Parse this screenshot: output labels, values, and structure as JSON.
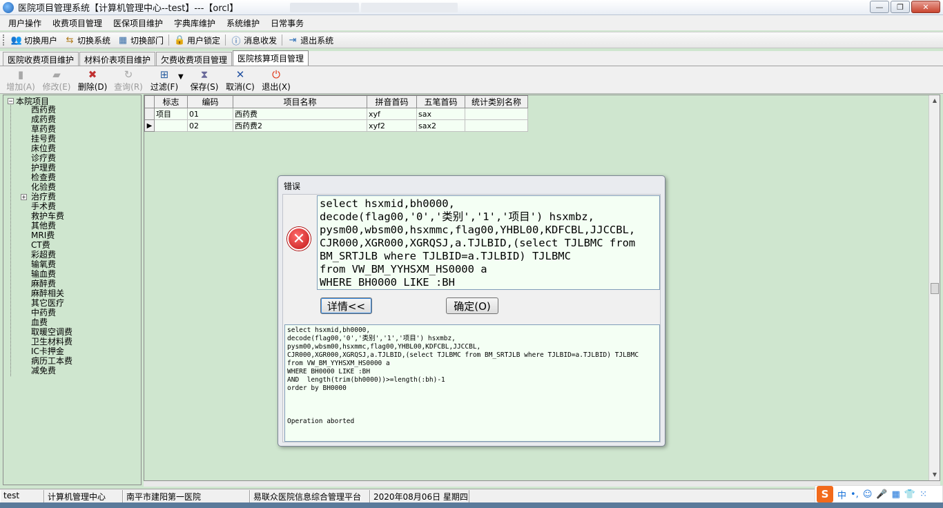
{
  "window": {
    "title": "医院项目管理系统【计算机管理中心--test】---【orcl】",
    "controls": [
      "—",
      "❐",
      "✕"
    ]
  },
  "menu": [
    "用户操作",
    "收费项目管理",
    "医保项目维护",
    "字典库维护",
    "系统维护",
    "日常事务"
  ],
  "toolbar": {
    "switch_user": "切换用户",
    "switch_system": "切换系统",
    "switch_dept": "切换部门",
    "lock_user": "用户锁定",
    "messages": "消息收发",
    "exit_system": "退出系统"
  },
  "tabs": [
    "医院收费项目维护",
    "材料价表项目维护",
    "欠费收费项目管理",
    "医院核算项目管理"
  ],
  "actions": {
    "add": "增加(A)",
    "edit": "修改(E)",
    "delete": "删除(D)",
    "query": "查询(R)",
    "filter": "过滤(F)",
    "save": "保存(S)",
    "cancel": "取消(C)",
    "exit": "退出(X)"
  },
  "tree": {
    "root": "本院项目",
    "root_expander": "−",
    "sub_expander": "+",
    "items": [
      "西药费",
      "成药费",
      "草药费",
      "挂号费",
      "床位费",
      "诊疗费",
      "护理费",
      "检查费",
      "化验费",
      "治疗费",
      "手术费",
      "救护车费",
      "其他费",
      "MRI费",
      "CT费",
      "彩超费",
      "输氧费",
      "输血费",
      "麻醉费",
      "麻醉相关",
      "其它医疗",
      "中药费",
      "血费",
      "取暖空调费",
      "卫生材料费",
      "IC卡押金",
      "病历工本费",
      "减免费"
    ]
  },
  "grid": {
    "columns": [
      "标志",
      "编码",
      "项目名称",
      "拼音首码",
      "五笔首码",
      "统计类别名称"
    ],
    "rows": [
      {
        "indicator": "",
        "flag": "项目",
        "code": "01",
        "name": "西药费",
        "pinyin": "xyf",
        "wubi": "sax",
        "category": ""
      },
      {
        "indicator": "▶",
        "flag": "",
        "code": "02",
        "name": "西药费2",
        "pinyin": "xyf2",
        "wubi": "sax2",
        "category": ""
      }
    ]
  },
  "dialog": {
    "title": "错误",
    "message": "select hsxmid,bh0000,\ndecode(flag00,'0','类别','1','项目') hsxmbz,\npysm00,wbsm00,hsxmmc,flag00,YHBL00,KDFCBL,JJCCBL,\nCJR000,XGR000,XGRQSJ,a.TJLBID,(select TJLBMC from\nBM_SRTJLB where TJLBID=a.TJLBID) TJLBMC\nfrom VW_BM_YYHSXM_HS0000 a\nWHERE BH0000 LIKE :BH",
    "details_button": "详情<<",
    "ok_button": "确定(O)",
    "details": "select hsxmid,bh0000,\ndecode(flag00,'0','类别','1','项目') hsxmbz,\npysm00,wbsm00,hsxmmc,flag00,YHBL00,KDFCBL,JJCCBL,\nCJR000,XGR000,XGRQSJ,a.TJLBID,(select TJLBMC from BM_SRTJLB where TJLBID=a.TJLBID) TJLBMC\nfrom VW_BM_YYHSXM_HS0000 a\nWHERE BH0000 LIKE :BH\nAND  length(trim(bh0000))>=length(:bh)-1\norder by BH0000\n\n\n\nOperation aborted"
  },
  "status": {
    "user": "test",
    "dept": "计算机管理中心",
    "hospital": "南平市建阳第一医院",
    "platform": "易联众医院信息综合管理平台",
    "date": "2020年08月06日 星期四"
  },
  "ime": {
    "logo": "S",
    "mode": "中",
    "punct": "•,",
    "emoji": "☺",
    "mic": "🎤",
    "keyboard": "▦",
    "skin": "👕",
    "tools": "⁙"
  }
}
